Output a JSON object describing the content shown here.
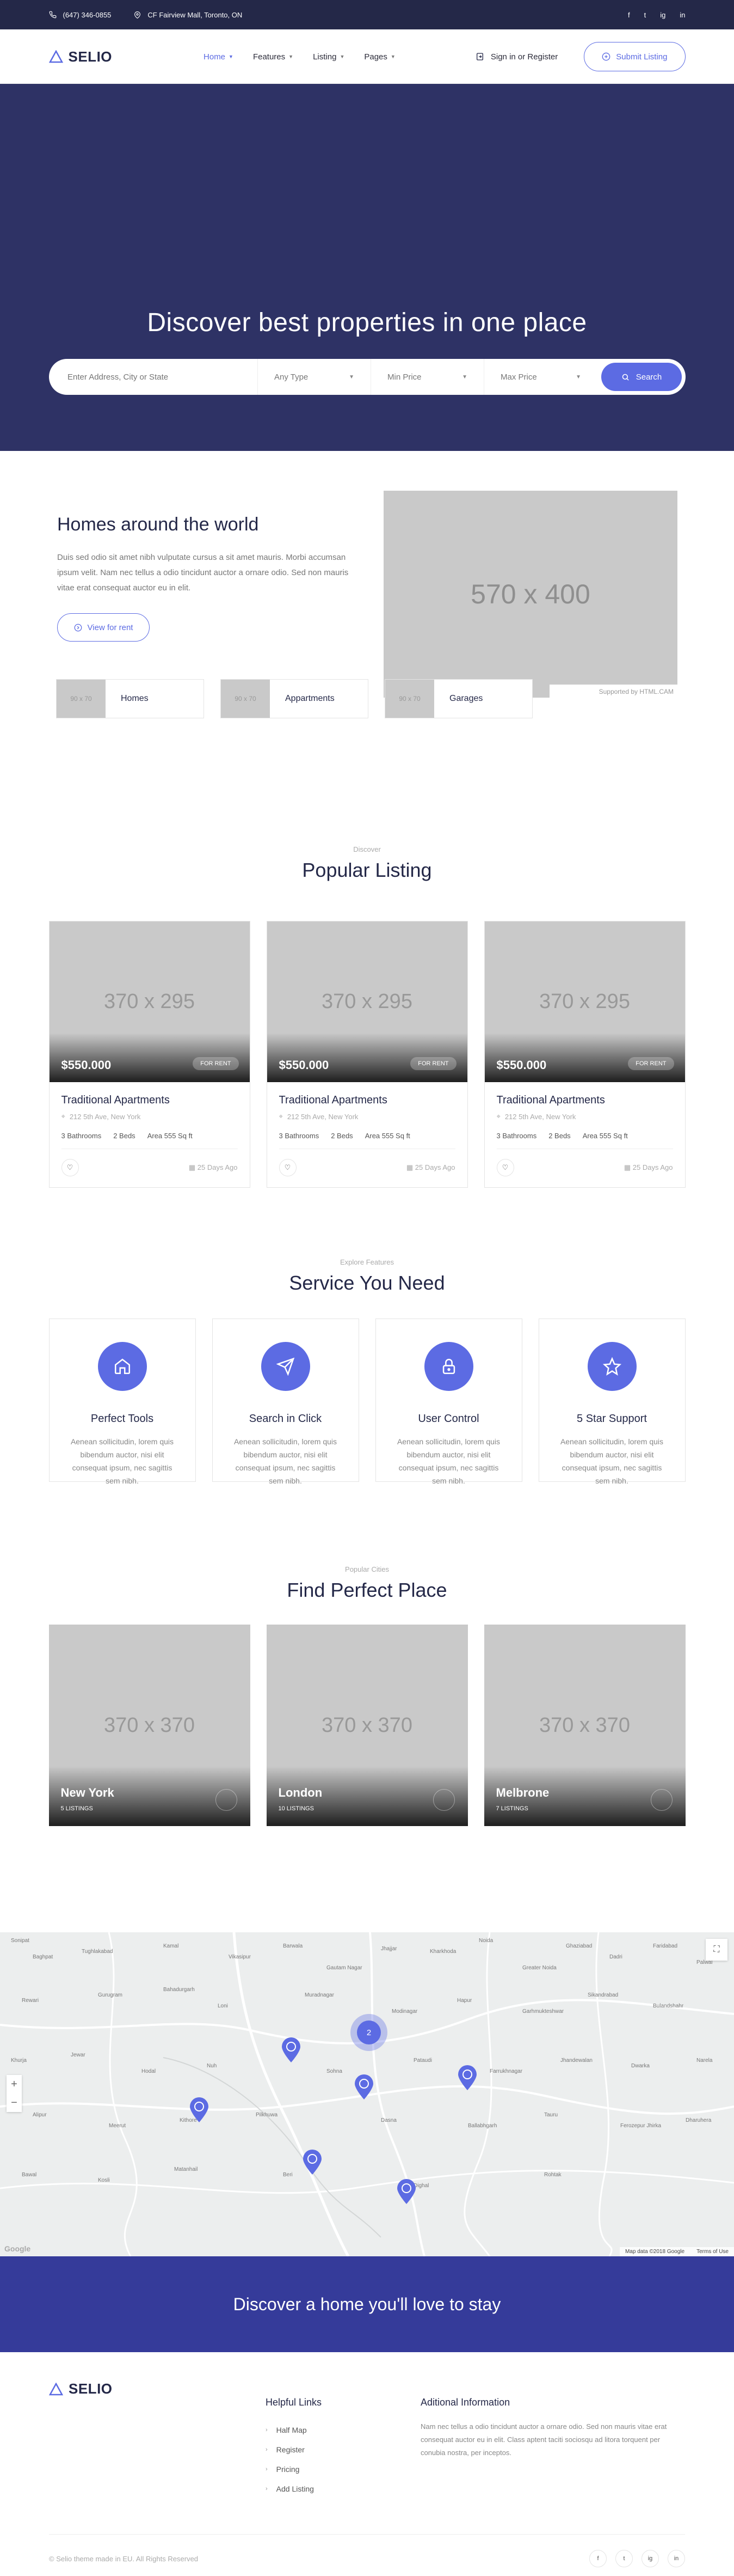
{
  "topbar": {
    "phone": "(647) 346-0855",
    "address": "CF Fairview Mall, Toronto, ON",
    "socials": [
      "f",
      "t",
      "ig",
      "in"
    ]
  },
  "header": {
    "logo": "SELIO",
    "nav": [
      {
        "label": "Home",
        "active": true
      },
      {
        "label": "Features",
        "active": false
      },
      {
        "label": "Listing",
        "active": false
      },
      {
        "label": "Pages",
        "active": false
      }
    ],
    "signin": "Sign in or Register",
    "submit": "Submit Listing"
  },
  "hero": {
    "title": "Discover best properties in one place",
    "location_placeholder": "Enter Address, City or State",
    "type": "Any Type",
    "min_price": "Min Price",
    "max_price": "Max Price",
    "search": "Search"
  },
  "homes": {
    "title": "Homes around the world",
    "description": "Duis sed odio sit amet nibh vulputate cursus a sit amet mauris. Morbi accumsan ipsum velit. Nam nec tellus a odio tincidunt auctor a ornare odio. Sed non mauris vitae erat consequat auctor eu in elit.",
    "button": "View for rent",
    "image": "570 x 400",
    "credit": "Supported by HTML.CAM",
    "categories": [
      {
        "thumb": "90 x 70",
        "label": "Homes"
      },
      {
        "thumb": "90 x 70",
        "label": "Appartments"
      },
      {
        "thumb": "90 x 70",
        "label": "Garages"
      }
    ]
  },
  "popular": {
    "small": "Discover",
    "title": "Popular Listing",
    "listings": [
      {
        "image": "370 x 295",
        "price": "$550.000",
        "badge": "FOR RENT",
        "title": "Traditional Apartments",
        "address": "212 5th Ave, New York",
        "baths": "3 Bathrooms",
        "beds": "2 Beds",
        "area": "Area 555 Sq ft",
        "date": "25 Days Ago"
      },
      {
        "image": "370 x 295",
        "price": "$550.000",
        "badge": "FOR RENT",
        "title": "Traditional Apartments",
        "address": "212 5th Ave, New York",
        "baths": "3 Bathrooms",
        "beds": "2 Beds",
        "area": "Area 555 Sq ft",
        "date": "25 Days Ago"
      },
      {
        "image": "370 x 295",
        "price": "$550.000",
        "badge": "FOR RENT",
        "title": "Traditional Apartments",
        "address": "212 5th Ave, New York",
        "baths": "3 Bathrooms",
        "beds": "2 Beds",
        "area": "Area 555 Sq ft",
        "date": "25 Days Ago"
      }
    ]
  },
  "services": {
    "small": "Explore Features",
    "title": "Service You Need",
    "items": [
      {
        "icon": "home-icon",
        "name": "Perfect Tools",
        "text": "Aenean sollicitudin, lorem quis bibendum auctor, nisi elit consequat ipsum, nec sagittis sem nibh."
      },
      {
        "icon": "send-icon",
        "name": "Search in Click",
        "text": "Aenean sollicitudin, lorem quis bibendum auctor, nisi elit consequat ipsum, nec sagittis sem nibh."
      },
      {
        "icon": "lock-icon",
        "name": "User Control",
        "text": "Aenean sollicitudin, lorem quis bibendum auctor, nisi elit consequat ipsum, nec sagittis sem nibh."
      },
      {
        "icon": "star-icon",
        "name": "5 Star Support",
        "text": "Aenean sollicitudin, lorem quis bibendum auctor, nisi elit consequat ipsum, nec sagittis sem nibh."
      }
    ]
  },
  "cities": {
    "small": "Popular Cities",
    "title": "Find Perfect Place",
    "items": [
      {
        "image": "370 x 370",
        "name": "New York",
        "count": "5 LISTINGS"
      },
      {
        "image": "370 x 370",
        "name": "London",
        "count": "10 LISTINGS"
      },
      {
        "image": "370 x 370",
        "name": "Melbrone",
        "count": "7 LISTINGS"
      }
    ]
  },
  "map": {
    "cluster": "2",
    "map_data": "Map data ©2018 Google",
    "terms": "Terms of Use",
    "google": "Google",
    "zoom_in": "+",
    "zoom_out": "−",
    "labels": [
      "Sonipat",
      "Baghpat",
      "Tughlakabad",
      "Kamal",
      "Vikasipur",
      "Barwala",
      "Gautam Nagar",
      "Jhajjar",
      "Kharkhoda",
      "Noida",
      "Greater Noida",
      "Ghaziabad",
      "Dadri",
      "Faridabad",
      "Palwal",
      "Rewari",
      "Gurugram",
      "Bahadurgarh",
      "Loni",
      "Muradnagar",
      "Modinagar",
      "Hapur",
      "Garhmukteshwar",
      "Sikandrabad",
      "Bulandshahr",
      "Khurja",
      "Jewar",
      "Hodal",
      "Nuh",
      "Sohna",
      "Pataudi",
      "Farrukhnagar",
      "Jhandewalan",
      "Dwarka",
      "Narela",
      "Alipur",
      "Meerut",
      "Kithore",
      "Pilkhuwa",
      "Dasna",
      "Ballabhgarh",
      "Tauru",
      "Ferozepur Jhirka",
      "Dharuhera",
      "Bawal",
      "Kosli",
      "Matanhail",
      "Beri",
      "Dighal",
      "Rohtak"
    ]
  },
  "cta": {
    "title": "Discover a home you'll love to stay"
  },
  "footer": {
    "logo": "SELIO",
    "links_title": "Helpful Links",
    "links": [
      "Half Map",
      "Register",
      "Pricing",
      "Add Listing"
    ],
    "info_title": "Aditional Information",
    "info": "Nam nec tellus a odio tincidunt auctor a ornare odio. Sed non mauris vitae erat consequat auctor eu in elit. Class aptent taciti sociosqu ad litora torquent per conubia nostra, per inceptos.",
    "copyright": "© Selio theme made in EU. All Rights Reserved",
    "socials": [
      "f",
      "t",
      "ig",
      "in"
    ]
  },
  "colors": {
    "accent": "#5c6be3",
    "dark": "#242848",
    "hero": "#2e3265",
    "cta": "#353b9a"
  }
}
